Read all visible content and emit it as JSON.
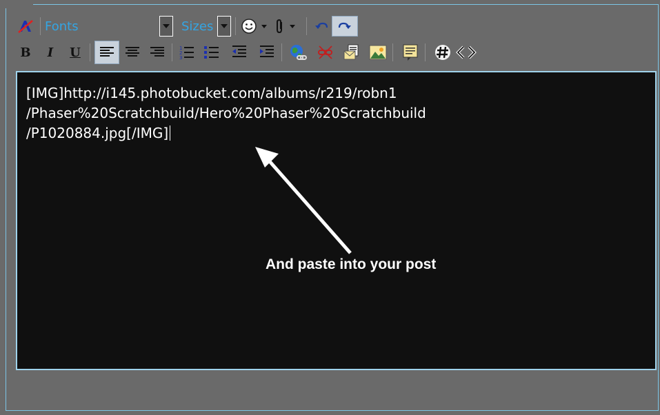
{
  "toolbar": {
    "fonts_label": "Fonts",
    "sizes_label": "Sizes"
  },
  "editor": {
    "lines": [
      "[IMG]http://i145.photobucket.com/albums/r219/robn1",
      "/Phaser%20Scratchbuild/Hero%20Phaser%20Scratchbuild",
      "/P1020884.jpg[/IMG]"
    ]
  },
  "annotation": {
    "text": "And paste into your post"
  },
  "colors": {
    "background": "#6a6a6a",
    "editor_bg": "#101010",
    "link_blue": "#34a5e3",
    "frame_border": "#7cc6e6"
  }
}
